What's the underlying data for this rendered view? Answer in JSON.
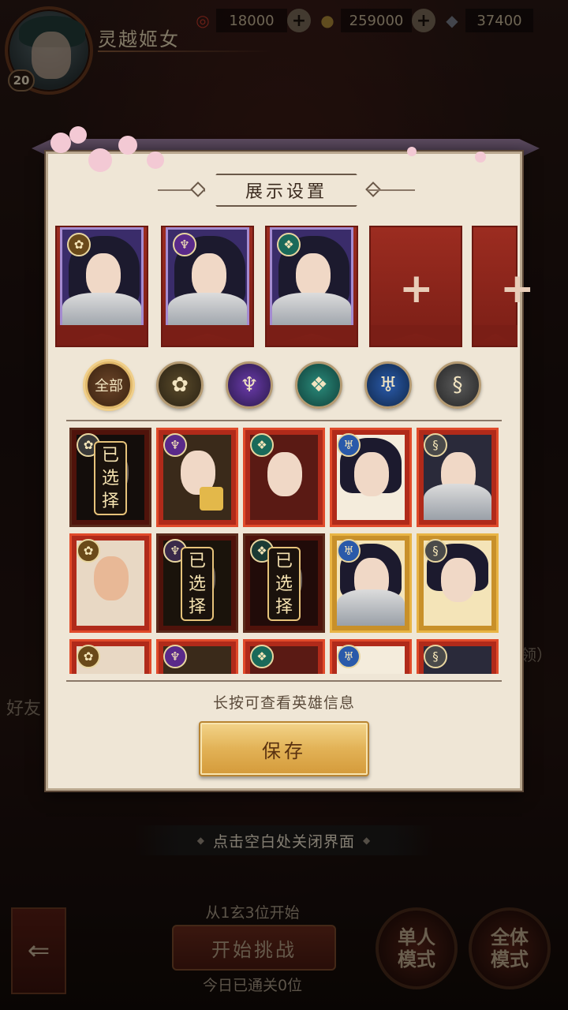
{
  "player": {
    "name": "灵越姬女",
    "level": "20"
  },
  "resources": [
    {
      "icon": "spiral-gem-icon",
      "value": "18000"
    },
    {
      "icon": "coin-icon",
      "value": "259000"
    },
    {
      "icon": "ticket-icon",
      "value": "37400"
    }
  ],
  "dialog": {
    "title": "展示设置",
    "long_press_hint": "长按可查看英雄信息",
    "save_label": "保存",
    "selected_tag": [
      "已",
      "选",
      "择"
    ],
    "filters": {
      "all_label": "全部",
      "factions": [
        "lotus-faction",
        "demon-faction",
        "jade-faction",
        "water-faction",
        "dragon-faction"
      ]
    }
  },
  "background": {
    "close_hint": "点击空白处关闭界面",
    "start_from": "从1玄3位开始",
    "start_button": "开始挑战",
    "cleared_today": "今日已通关0位",
    "single_mode": "单人\n模式",
    "all_mode": "全体\n模式",
    "friend_label": "好友",
    "side_text": "领）"
  },
  "colors": {
    "dialog_bg": "#efe6d6",
    "red_frame": "#e04a2a",
    "gold_frame": "#e8b444",
    "accent_gold": "#e2b256"
  }
}
